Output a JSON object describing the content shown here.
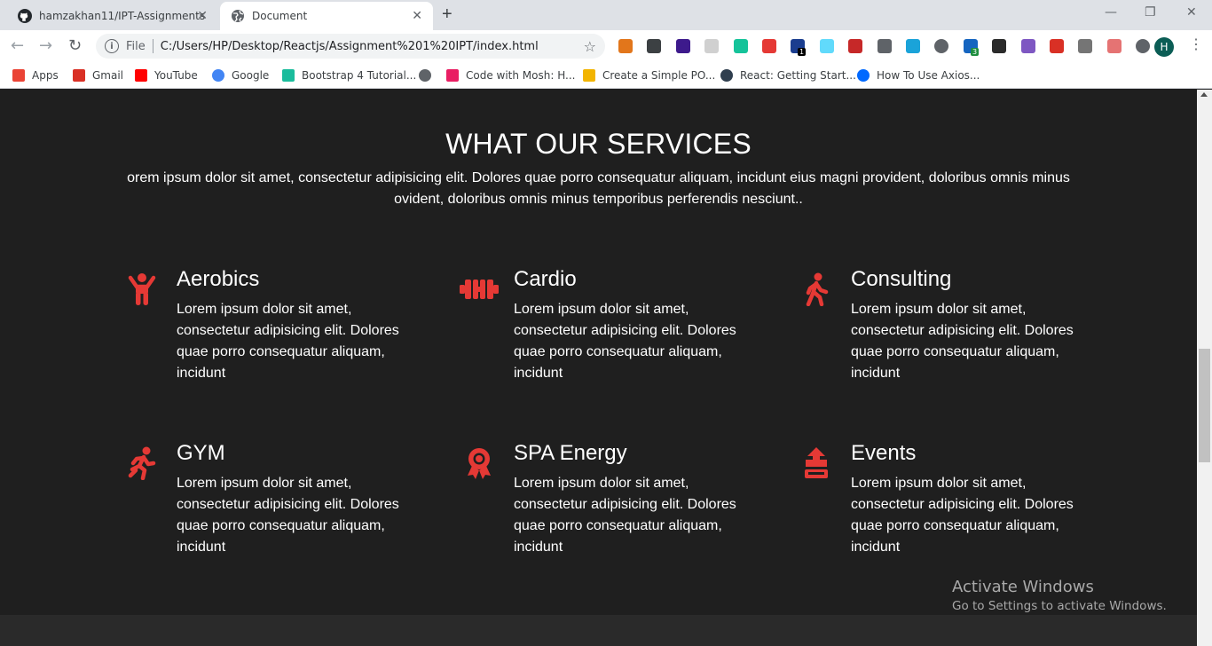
{
  "browser": {
    "tabs": [
      {
        "title": "hamzakhan11/IPT-Assignments",
        "icon": "github-icon",
        "active": false
      },
      {
        "title": "Document",
        "icon": "globe-icon",
        "active": true
      }
    ],
    "close_glyph": "✕",
    "new_tab_glyph": "+",
    "window_controls": {
      "minimize": "—",
      "restore": "❐",
      "close": "✕"
    },
    "nav": {
      "back": "←",
      "forward": "→",
      "reload": "↻"
    },
    "address": {
      "info_glyph": "i",
      "scheme": "File",
      "url": "C:/Users/HP/Desktop/Reactjs/Assignment%201%20IPT/index.html",
      "star_glyph": "☆"
    },
    "extensions": [
      {
        "name": "metamask-icon",
        "color": "#e2761b"
      },
      {
        "name": "screen-capture-icon",
        "color": "#3c4043"
      },
      {
        "name": "cube-icon",
        "color": "#3d1a8c"
      },
      {
        "name": "grid-ext-icon",
        "color": "#d0d0d0"
      },
      {
        "name": "grammarly-icon",
        "color": "#15c39a"
      },
      {
        "name": "pokeball-icon",
        "color": "#e53935"
      },
      {
        "name": "link-ext-icon",
        "color": "#1a3d8f",
        "badge": "1"
      },
      {
        "name": "react-devtools-icon",
        "color": "#61dafb"
      },
      {
        "name": "pdf-ext-icon",
        "color": "#c62828"
      },
      {
        "name": "mail-ext-icon",
        "color": "#5f6368"
      },
      {
        "name": "s-ext-icon",
        "color": "#1aa3d9"
      },
      {
        "name": "puzzle-grey-icon",
        "color": "#5f6368"
      },
      {
        "name": "gear-ext-icon",
        "color": "#1565c0",
        "badge": "3"
      },
      {
        "name": "ball-ext-icon",
        "color": "#2b2b2b"
      },
      {
        "name": "s-purple-icon",
        "color": "#7e57c2"
      },
      {
        "name": "gmail-ext-icon",
        "color": "#d93025"
      },
      {
        "name": "download-ext-icon",
        "color": "#757575"
      },
      {
        "name": "rocket-ext-icon",
        "color": "#e57373"
      },
      {
        "name": "extensions-puzzle-icon",
        "color": "#5f6368"
      }
    ],
    "profile_initial": "H",
    "menu_glyph": "⋮",
    "bookmarks": [
      {
        "label": "Apps",
        "icon": "apps-grid-icon",
        "color": "#ea4335"
      },
      {
        "label": "Gmail",
        "icon": "gmail-icon",
        "color": "#d93025"
      },
      {
        "label": "YouTube",
        "icon": "youtube-icon",
        "color": "#ff0000"
      },
      {
        "label": "Google",
        "icon": "google-icon",
        "color": "#4285f4"
      },
      {
        "label": "Bootstrap 4 Tutorial...",
        "icon": "bootstrap-icon",
        "color": "#1abc9c"
      },
      {
        "label": "",
        "icon": "globe-bookmark-icon",
        "color": "#5f6368"
      },
      {
        "label": "Code with Mosh: H...",
        "icon": "mosh-icon",
        "color": "#e91e63"
      },
      {
        "label": "Create a Simple PO...",
        "icon": "s-bookmark-icon",
        "color": "#f2b400"
      },
      {
        "label": "React: Getting Start...",
        "icon": "dc-icon",
        "color": "#2f3e4e"
      },
      {
        "label": "How To Use Axios...",
        "icon": "do-icon",
        "color": "#0069ff"
      }
    ]
  },
  "colors": {
    "page_bg": "#1f1f1f",
    "accent": "#e53935",
    "text": "#ffffff"
  },
  "page": {
    "title": "WHAT OUR SERVICES",
    "subtitle": "orem ipsum dolor sit amet, consectetur adipisicing elit. Dolores quae porro consequatur aliquam, incidunt eius magni provident, doloribus omnis minus ovident, doloribus omnis minus temporibus perferendis nesciunt..",
    "services": [
      {
        "title": "Aerobics",
        "icon": "aerobics-child-icon",
        "text": "Lorem ipsum dolor sit amet, consectetur adipisicing elit. Dolores quae porro consequatur aliquam, incidunt"
      },
      {
        "title": "Cardio",
        "icon": "dumbbell-icon",
        "text": "Lorem ipsum dolor sit amet, consectetur adipisicing elit. Dolores quae porro consequatur aliquam, incidunt"
      },
      {
        "title": "Consulting",
        "icon": "walking-icon",
        "text": "Lorem ipsum dolor sit amet, consectetur adipisicing elit. Dolores quae porro consequatur aliquam, incidunt"
      },
      {
        "title": "GYM",
        "icon": "running-icon",
        "text": "Lorem ipsum dolor sit amet, consectetur adipisicing elit. Dolores quae porro consequatur aliquam, incidunt"
      },
      {
        "title": "SPA Energy",
        "icon": "award-ribbon-icon",
        "text": "Lorem ipsum dolor sit amet, consectetur adipisicing elit. Dolores quae porro consequatur aliquam, incidunt"
      },
      {
        "title": "Events",
        "icon": "stamp-icon",
        "text": "Lorem ipsum dolor sit amet, consectetur adipisicing elit. Dolores quae porro consequatur aliquam, incidunt"
      }
    ]
  },
  "os_watermark": {
    "line1": "Activate Windows",
    "line2": "Go to Settings to activate Windows."
  }
}
